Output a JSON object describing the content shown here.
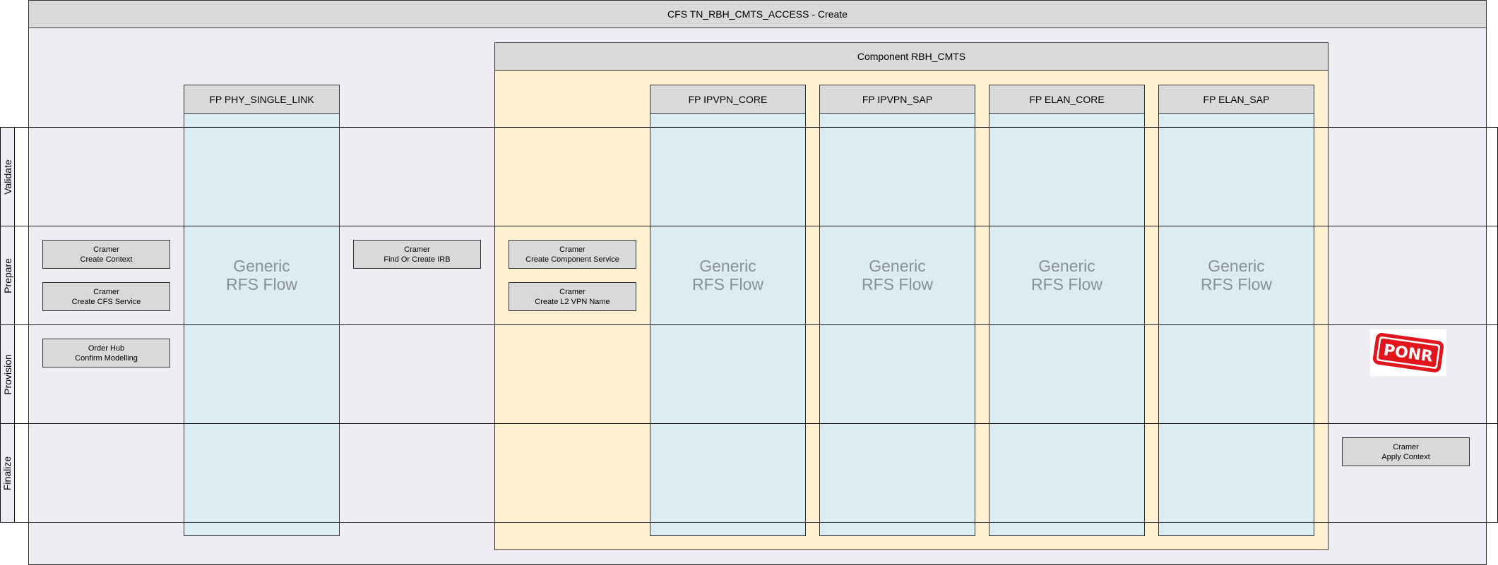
{
  "title": "CFS TN_RBH_CMTS_ACCESS - Create",
  "component_title": "Component RBH_CMTS",
  "flow_points": [
    {
      "label": "FP PHY_SINGLE_LINK"
    },
    {
      "label": "FP IPVPN_CORE"
    },
    {
      "label": "FP IPVPN_SAP"
    },
    {
      "label": "FP ELAN_CORE"
    },
    {
      "label": "FP ELAN_SAP"
    }
  ],
  "generic_flow": {
    "line1": "Generic",
    "line2": "RFS Flow"
  },
  "lanes": [
    {
      "label": "Validate"
    },
    {
      "label": "Prepare"
    },
    {
      "label": "Provision"
    },
    {
      "label": "Finalize"
    }
  ],
  "tasks": {
    "create_context": {
      "system": "Cramer",
      "action": "Create Context"
    },
    "create_cfs_service": {
      "system": "Cramer",
      "action": "Create CFS Service"
    },
    "confirm_modelling": {
      "system": "Order Hub",
      "action": "Confirm Modelling"
    },
    "find_or_create_irb": {
      "system": "Cramer",
      "action": "Find Or Create IRB"
    },
    "create_component_service": {
      "system": "Cramer",
      "action": "Create Component Service"
    },
    "create_l2_vpn_name": {
      "system": "Cramer",
      "action": "Create L2 VPN Name"
    },
    "apply_context": {
      "system": "Cramer",
      "action": "Apply Context"
    }
  },
  "ponr_stamp": {
    "text": "PONR",
    "color": "#e2141c"
  }
}
